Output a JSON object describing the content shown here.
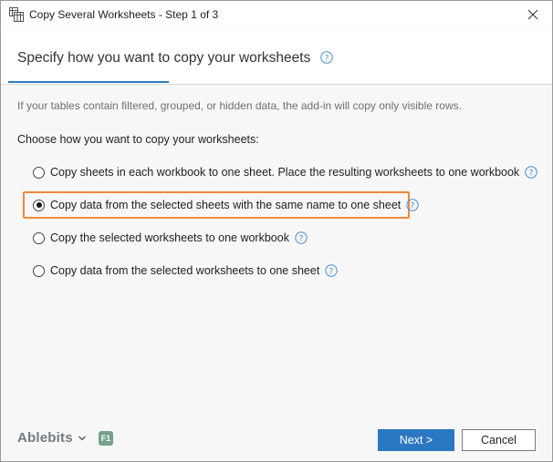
{
  "window": {
    "title": "Copy Several Worksheets - Step 1 of 3",
    "app_icon": "worksheets-copy-icon",
    "close_icon": "close-icon"
  },
  "header": {
    "title": "Specify how you want to copy your worksheets",
    "help_icon": "help-icon"
  },
  "info_text": "If your tables contain filtered, grouped, or hidden data, the add-in will copy only visible rows.",
  "choose_label": "Choose how you want to copy your worksheets:",
  "options": [
    {
      "label": "Copy sheets in each workbook to one sheet. Place the resulting worksheets to one workbook",
      "selected": false
    },
    {
      "label": "Copy data from the selected sheets with the same name to one sheet",
      "selected": true
    },
    {
      "label": "Copy the selected worksheets to one workbook",
      "selected": false
    },
    {
      "label": "Copy data from the selected worksheets to one sheet",
      "selected": false
    }
  ],
  "footer": {
    "brand": "Ablebits",
    "brand_icon": "chevron-down-icon",
    "f1_badge": "F1",
    "next_label": "Next >",
    "cancel_label": "Cancel"
  },
  "colors": {
    "accent": "#2b78c2",
    "highlight": "#f08a3c",
    "help": "#4a8fd4",
    "f1_badge": "#76a28a"
  }
}
